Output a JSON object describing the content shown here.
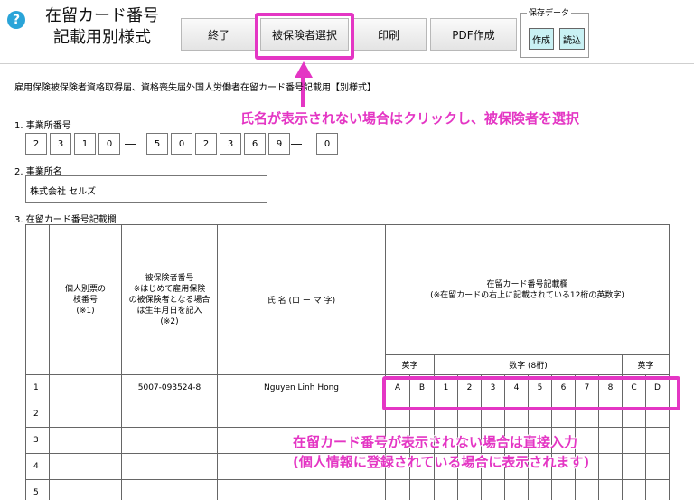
{
  "header": {
    "help_icon": "?",
    "title_line1": "在留カード番号",
    "title_line2": "記載用別様式"
  },
  "toolbar": {
    "end_label": "終了",
    "select_insured_label": "被保険者選択",
    "print_label": "印刷",
    "pdf_label": "PDF作成",
    "save_data_label": "保存データ",
    "create_label": "作成",
    "load_label": "読込"
  },
  "form": {
    "title": "雇用保険被保険者資格取得届、資格喪失届外国人労働者在留カード番号記載用【別様式】",
    "sec1_label": "1. 事業所番号",
    "office_number_digits": [
      "2",
      "3",
      "1",
      "0",
      "5",
      "0",
      "2",
      "3",
      "6",
      "9",
      "0"
    ],
    "dash": "―",
    "sec2_label": "2. 事業所名",
    "office_name": "株式会社 セルズ",
    "sec3_label": "3. 在留カード番号記載欄"
  },
  "annotations": {
    "select_hint": "氏名が表示されない場合はクリックし、被保険者を選択",
    "card_hint_line1": "在留カード番号が表示されない場合は直接入力",
    "card_hint_line2": "(個人情報に登録されている場合に表示されます)"
  },
  "table": {
    "col_row_no_header": "個人別票の\n枝番号\n(※1)",
    "col_insured_no_header": "被保険者番号\n※はじめて雇用保険\nの被保険者となる場合\nは生年月日を記入\n(※2)",
    "col_name_header": "氏 名 (ロ ー マ 字)",
    "col_card_header": "在留カード番号記載欄\n(※在留カードの右上に記載されている12桁の英数字)",
    "sub_alpha1": "英字",
    "sub_digits": "数字 (8桁)",
    "sub_alpha2": "英字",
    "rows": [
      {
        "no": "1",
        "insured_no": "5007-093524-8",
        "name": "Nguyen Linh Hong",
        "card": [
          "A",
          "B",
          "1",
          "2",
          "3",
          "4",
          "5",
          "6",
          "7",
          "8",
          "C",
          "D"
        ]
      },
      {
        "no": "2",
        "insured_no": "",
        "name": "",
        "card": [
          "",
          "",
          "",
          "",
          "",
          "",
          "",
          "",
          "",
          "",
          "",
          ""
        ]
      },
      {
        "no": "3",
        "insured_no": "",
        "name": "",
        "card": [
          "",
          "",
          "",
          "",
          "",
          "",
          "",
          "",
          "",
          "",
          "",
          ""
        ]
      },
      {
        "no": "4",
        "insured_no": "",
        "name": "",
        "card": [
          "",
          "",
          "",
          "",
          "",
          "",
          "",
          "",
          "",
          "",
          "",
          ""
        ]
      },
      {
        "no": "5",
        "insured_no": "",
        "name": "",
        "card": [
          "",
          "",
          "",
          "",
          "",
          "",
          "",
          "",
          "",
          "",
          "",
          ""
        ]
      }
    ]
  },
  "colors": {
    "highlight": "#e436c4",
    "save_button_bg": "#c9f1f4",
    "help_icon": "#2aa4d8"
  }
}
